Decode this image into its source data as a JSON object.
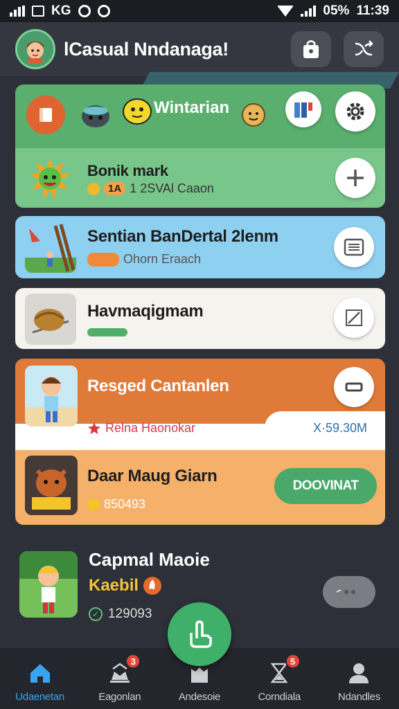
{
  "status_bar": {
    "left_text": "KG",
    "battery": "05%",
    "time": "11:39"
  },
  "header": {
    "title": "lCasual Nndanaga!",
    "avatar_icon": "boy-avatar-icon",
    "buttons": [
      "shopping-bag-icon",
      "shuffle-icon"
    ]
  },
  "card1": {
    "label": "Wintarian",
    "title": "Bonik mark",
    "pill": "1A",
    "subtitle": "1 2SVAl Caaon",
    "icons": [
      "book-icon",
      "helmet-icon",
      "lemon-face-icon",
      "cookie-face-icon",
      "calendar-icon",
      "gear-icon",
      "plus-icon"
    ]
  },
  "card2": {
    "title": "Sentian BanDertal 2lenm",
    "subtitle": "Ohorn Eraach",
    "action_icon": "list-icon"
  },
  "card3": {
    "title": "Havmaqigmam",
    "progress": 0.3,
    "action_icon": "expand-icon"
  },
  "card4": {
    "title": "Resged Cantanlen",
    "tag": "Relna Haonokar",
    "price": "X·59.30M",
    "second_title": "Daar Maug Giarn",
    "second_count": "850493",
    "download_label": "DOOVINAT",
    "colors": {
      "top": "#e07a38",
      "bottom": "#f5b06a",
      "button": "#4aa86a"
    }
  },
  "featured": {
    "title": "Capmal Maoie",
    "subtitle": "Kaebil",
    "count": "129093"
  },
  "bottom_nav": [
    {
      "label": "Udaenetan",
      "icon": "home-icon",
      "active": true,
      "badge": ""
    },
    {
      "label": "Eagonlan",
      "icon": "trophy-icon",
      "active": false,
      "badge": "3"
    },
    {
      "label": "Andesoie",
      "icon": "castle-icon",
      "active": false,
      "badge": ""
    },
    {
      "label": "Corndiala",
      "icon": "hourglass-icon",
      "active": false,
      "badge": "5"
    },
    {
      "label": "Ndandles",
      "icon": "user-icon",
      "active": false,
      "badge": ""
    }
  ]
}
